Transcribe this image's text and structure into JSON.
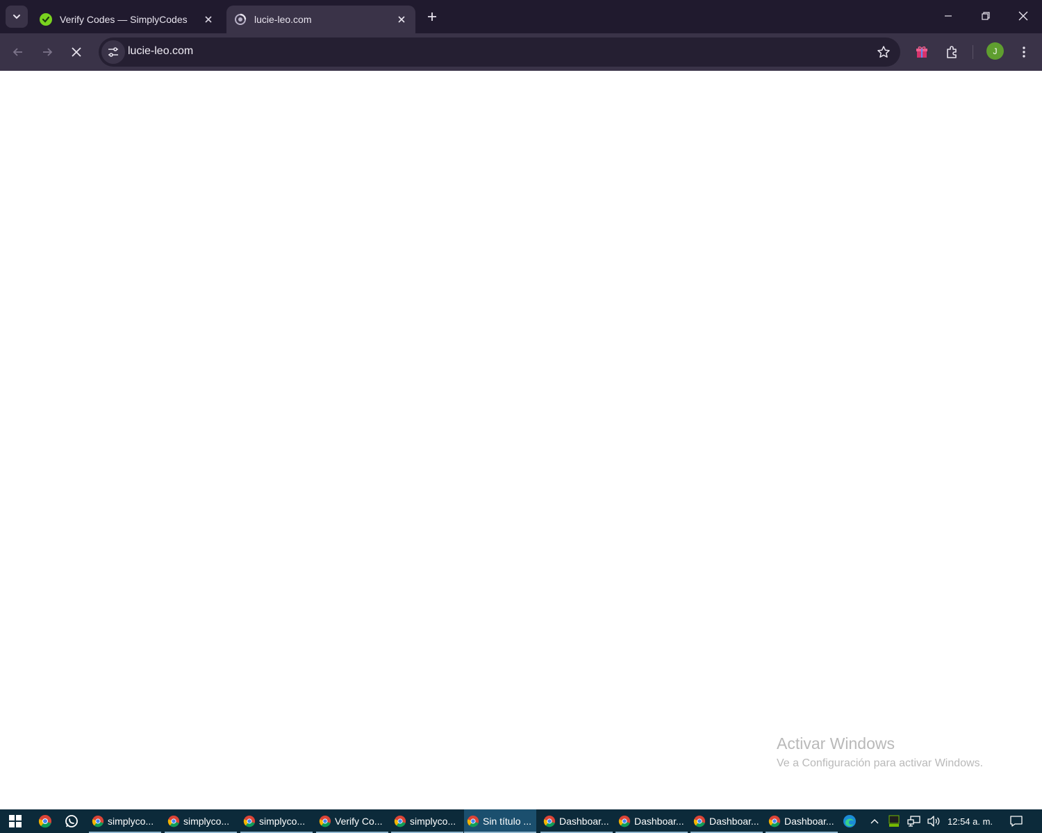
{
  "browser": {
    "tabs": [
      {
        "title": "Verify Codes — SimplyCodes",
        "active": false,
        "favicon": "simplycodes-icon"
      },
      {
        "title": "lucie-leo.com",
        "active": true,
        "favicon": "loading-globe-icon"
      }
    ],
    "address_bar": {
      "url": "lucie-leo.com"
    },
    "profile": {
      "initial": "J",
      "color": "#5f9e2f"
    }
  },
  "watermark": {
    "line1": "Activar Windows",
    "line2": "Ve a Configuración para activar Windows."
  },
  "taskbar": {
    "items": [
      {
        "label": "simplyco...",
        "active": false
      },
      {
        "label": "simplyco...",
        "active": false
      },
      {
        "label": "simplyco...",
        "active": false
      },
      {
        "label": "Verify Co...",
        "active": false
      },
      {
        "label": "simplyco...",
        "active": false
      },
      {
        "label": "Sin título ...",
        "active": true
      },
      {
        "label": "Dashboar...",
        "active": false
      },
      {
        "label": "Dashboar...",
        "active": false
      },
      {
        "label": "Dashboar...",
        "active": false
      },
      {
        "label": "Dashboar...",
        "active": false
      }
    ],
    "clock": "12:54 a. m."
  },
  "colors": {
    "tabstrip": "#201a2e",
    "toolbar": "#3a3348",
    "omnibox": "#251f32",
    "taskbar": "#0c2a3a",
    "accent_green": "#5f9e2f"
  }
}
